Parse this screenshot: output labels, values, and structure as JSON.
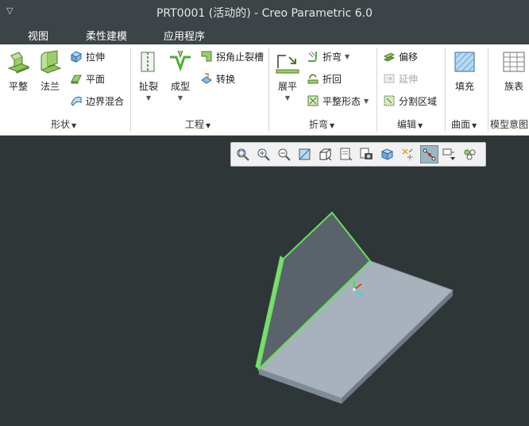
{
  "window": {
    "title": "PRT0001 (活动的) - Creo Parametric 6.0"
  },
  "tabs": [
    {
      "label": "视图"
    },
    {
      "label": "柔性建模"
    },
    {
      "label": "应用程序"
    }
  ],
  "ribbon": {
    "groups": {
      "shape": {
        "label": "形状",
        "planar": "平整",
        "flange": "法兰",
        "extrude": "拉伸",
        "flat": "平面",
        "boundary_blend": "边界混合"
      },
      "engineering": {
        "label": "工程",
        "rip": "扯裂",
        "form": "成型",
        "corner_relief": "拐角止裂槽",
        "convert": "转换"
      },
      "bends": {
        "label": "折弯",
        "unbend": "展平",
        "bend": "折弯",
        "bend_back": "折回",
        "flat_state": "平整形态"
      },
      "editing": {
        "label": "编辑",
        "offset": "偏移",
        "extend": "延伸",
        "split_area": "分割区域"
      },
      "surfaces": {
        "label": "曲面",
        "fill": "填充"
      },
      "model_intent": {
        "label": "模型意图",
        "family_table": "族表"
      }
    }
  },
  "colors": {
    "title_bg": "#3c4447",
    "canvas_bg": "#2f3637",
    "selection_green": "#66e05a",
    "part_top": "#a7b2bd",
    "part_face": "#5a626c"
  },
  "view_toolbar": {
    "icons": [
      "refit-icon",
      "zoom-in-icon",
      "zoom-out-icon",
      "repaint-icon",
      "display-style-icon",
      "saved-orientations-icon",
      "view-manager-icon",
      "perspective-icon",
      "datum-display-icon",
      "spin-center-icon",
      "annotation-display-icon",
      "appearance-icon"
    ]
  }
}
